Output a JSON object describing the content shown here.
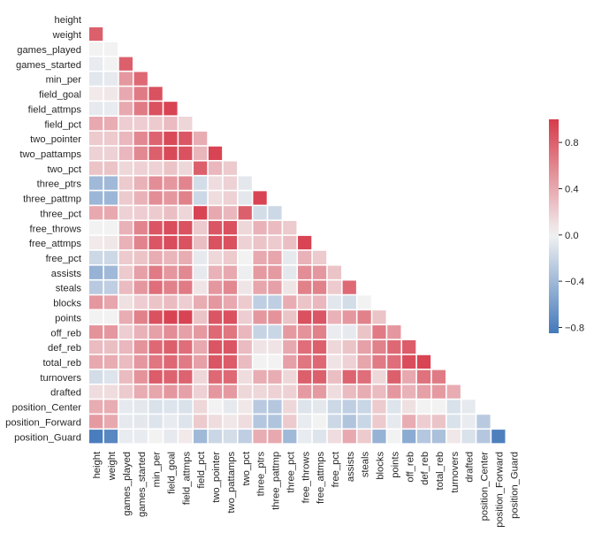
{
  "chart_data": {
    "type": "heatmap",
    "title": "",
    "xlabel": "",
    "ylabel": "",
    "mask": "upper-triangle",
    "labels": [
      "height",
      "weight",
      "games_played",
      "games_started",
      "min_per",
      "field_goal",
      "field_attmps",
      "field_pct",
      "two_pointer",
      "two_pattamps",
      "two_pct",
      "three_ptrs",
      "three_pattmp",
      "three_pct",
      "free_throws",
      "free_attmps",
      "free_pct",
      "assists",
      "steals",
      "blocks",
      "points",
      "off_reb",
      "def_reb",
      "total_reb",
      "turnovers",
      "drafted",
      "position_Center",
      "position_Forward",
      "position_Guard"
    ],
    "matrix_lower": [
      [],
      [
        0.8
      ],
      [
        0.0,
        0.0
      ],
      [
        -0.05,
        0.0,
        0.8
      ],
      [
        -0.08,
        -0.06,
        0.5,
        0.75
      ],
      [
        0.05,
        0.06,
        0.4,
        0.65,
        0.88
      ],
      [
        -0.06,
        -0.05,
        0.4,
        0.65,
        0.88,
        0.95
      ],
      [
        0.4,
        0.38,
        0.2,
        0.2,
        0.22,
        0.3,
        0.16
      ],
      [
        0.22,
        0.22,
        0.32,
        0.58,
        0.78,
        0.92,
        0.85,
        0.38
      ],
      [
        0.18,
        0.18,
        0.32,
        0.58,
        0.8,
        0.92,
        0.88,
        0.33,
        0.95
      ],
      [
        0.25,
        0.25,
        0.15,
        0.18,
        0.18,
        0.25,
        0.15,
        0.8,
        0.32,
        0.22
      ],
      [
        -0.4,
        -0.4,
        0.22,
        0.35,
        0.55,
        0.5,
        0.6,
        -0.15,
        0.12,
        0.18,
        -0.07
      ],
      [
        -0.42,
        -0.42,
        0.22,
        0.35,
        0.55,
        0.5,
        0.62,
        -0.18,
        0.12,
        0.18,
        -0.07,
        0.95
      ],
      [
        0.4,
        0.4,
        0.18,
        0.2,
        0.22,
        0.28,
        0.16,
        0.95,
        0.4,
        0.32,
        0.8,
        -0.15,
        -0.18
      ],
      [
        0.0,
        0.0,
        0.35,
        0.6,
        0.85,
        0.9,
        0.88,
        0.22,
        0.85,
        0.88,
        0.15,
        0.35,
        0.3,
        0.22
      ],
      [
        0.05,
        0.06,
        0.35,
        0.6,
        0.85,
        0.9,
        0.88,
        0.28,
        0.88,
        0.88,
        0.18,
        0.25,
        0.22,
        0.28,
        0.95
      ],
      [
        -0.18,
        -0.18,
        0.22,
        0.25,
        0.38,
        0.33,
        0.38,
        -0.06,
        0.15,
        0.22,
        0.0,
        0.4,
        0.42,
        -0.06,
        0.35,
        0.22
      ],
      [
        -0.45,
        -0.4,
        0.22,
        0.45,
        0.65,
        0.5,
        0.58,
        -0.06,
        0.35,
        0.4,
        -0.03,
        0.48,
        0.48,
        -0.07,
        0.55,
        0.5,
        0.25
      ],
      [
        -0.28,
        -0.25,
        0.3,
        0.5,
        0.72,
        0.62,
        0.65,
        0.07,
        0.5,
        0.58,
        0.07,
        0.42,
        0.45,
        0.07,
        0.62,
        0.62,
        0.22,
        0.75
      ],
      [
        0.5,
        0.42,
        0.1,
        0.2,
        0.25,
        0.3,
        0.2,
        0.38,
        0.5,
        0.4,
        0.22,
        -0.25,
        -0.25,
        0.38,
        0.25,
        0.32,
        -0.08,
        -0.15,
        0.0
      ],
      [
        0.0,
        0.0,
        0.38,
        0.62,
        0.88,
        0.95,
        0.95,
        0.25,
        0.85,
        0.88,
        0.2,
        0.5,
        0.52,
        0.25,
        0.88,
        0.85,
        0.35,
        0.5,
        0.62,
        0.25
      ],
      [
        0.52,
        0.5,
        0.2,
        0.35,
        0.45,
        0.55,
        0.45,
        0.48,
        0.75,
        0.68,
        0.32,
        -0.22,
        -0.2,
        0.48,
        0.52,
        0.62,
        -0.04,
        -0.06,
        0.25,
        0.65,
        0.5
      ],
      [
        0.3,
        0.28,
        0.32,
        0.52,
        0.75,
        0.8,
        0.72,
        0.4,
        0.85,
        0.85,
        0.3,
        0.08,
        0.08,
        0.4,
        0.72,
        0.8,
        0.15,
        0.25,
        0.45,
        0.62,
        0.75,
        0.82
      ],
      [
        0.4,
        0.38,
        0.3,
        0.5,
        0.68,
        0.75,
        0.65,
        0.45,
        0.85,
        0.82,
        0.3,
        0.0,
        0.0,
        0.45,
        0.68,
        0.75,
        0.08,
        0.18,
        0.42,
        0.65,
        0.72,
        0.9,
        0.95
      ],
      [
        -0.15,
        -0.1,
        0.3,
        0.52,
        0.82,
        0.78,
        0.78,
        0.15,
        0.75,
        0.75,
        0.12,
        0.38,
        0.38,
        0.15,
        0.8,
        0.8,
        0.28,
        0.78,
        0.72,
        0.15,
        0.8,
        0.4,
        0.7,
        0.65
      ],
      [
        0.12,
        0.12,
        0.22,
        0.38,
        0.42,
        0.5,
        0.45,
        0.18,
        0.5,
        0.48,
        0.15,
        0.15,
        0.18,
        0.18,
        0.48,
        0.48,
        0.12,
        0.3,
        0.38,
        0.3,
        0.5,
        0.35,
        0.45,
        0.48,
        0.38
      ],
      [
        0.38,
        0.38,
        -0.06,
        -0.07,
        -0.12,
        -0.1,
        -0.12,
        0.15,
        0.0,
        -0.06,
        0.06,
        -0.28,
        -0.3,
        0.15,
        -0.1,
        -0.07,
        -0.18,
        -0.25,
        -0.2,
        0.22,
        -0.1,
        0.1,
        0.0,
        0.0,
        -0.12,
        -0.06
      ],
      [
        0.48,
        0.4,
        -0.06,
        -0.07,
        -0.1,
        -0.05,
        -0.1,
        0.22,
        0.12,
        0.06,
        0.12,
        -0.3,
        -0.32,
        0.22,
        -0.05,
        0.0,
        -0.18,
        -0.32,
        -0.2,
        0.22,
        -0.06,
        0.38,
        0.2,
        0.25,
        -0.12,
        -0.05,
        -0.28
      ],
      [
        -0.82,
        -0.75,
        -0.05,
        -0.05,
        0.0,
        -0.06,
        0.05,
        -0.4,
        -0.2,
        -0.15,
        -0.25,
        0.38,
        0.4,
        -0.4,
        -0.05,
        -0.1,
        0.12,
        0.4,
        0.22,
        -0.45,
        0.0,
        -0.5,
        -0.3,
        -0.35,
        0.06,
        -0.12,
        -0.3,
        -0.8
      ]
    ],
    "colorbar": {
      "ticks": [
        0.8,
        0.4,
        0.0,
        -0.4,
        -0.8
      ],
      "tick_labels": [
        "0.8",
        "0.4",
        "0.0",
        "−0.4",
        "−0.8"
      ],
      "range": [
        -0.85,
        1.0
      ]
    },
    "colors": {
      "negative": "#4479bb",
      "center": "#f2f2f2",
      "positive": "#d73b4b"
    }
  }
}
